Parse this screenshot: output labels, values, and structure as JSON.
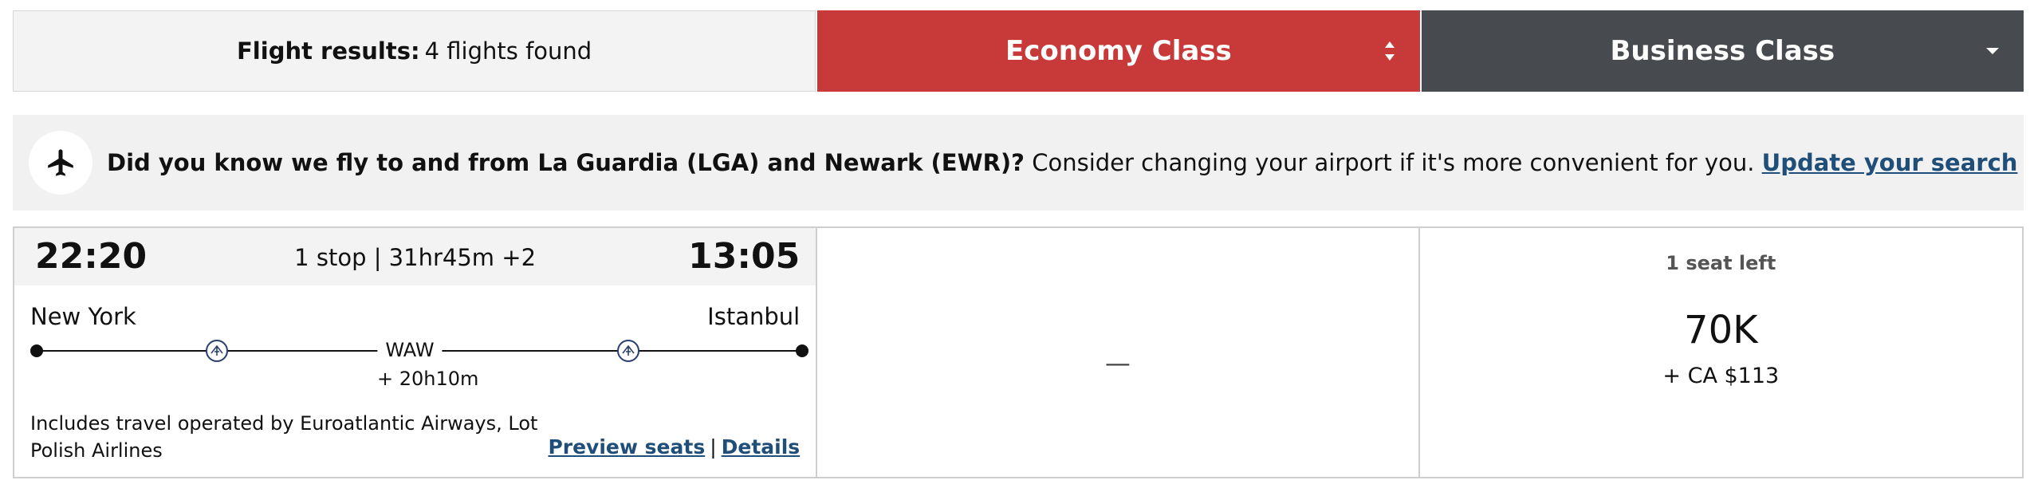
{
  "header": {
    "results_label": "Flight results:",
    "results_count": "4 flights found",
    "cabins": [
      {
        "label": "Economy Class",
        "color": "#c8393a"
      },
      {
        "label": "Business Class",
        "color": "#474a4f"
      }
    ]
  },
  "banner": {
    "icon": "airplane-icon",
    "strong_text": "Did you know we fly to and from La Guardia (LGA) and Newark (EWR)?",
    "text": " Consider changing your airport if it's more convenient for you.",
    "link": "Update your search"
  },
  "flight": {
    "departure_time": "22:20",
    "arrival_time": "13:05",
    "stops_summary": "1 stop | 31hr45m",
    "day_offset": "+2",
    "origin": "New York",
    "destination": "Istanbul",
    "stop_code": "WAW",
    "layover": "+ 20h10m",
    "operators": "Includes travel operated by Euroatlantic Airways, Lot Polish Airlines",
    "preview_seats_link": "Preview seats",
    "separator": "|",
    "details_link": "Details",
    "economy_fare": "—",
    "business_fare": {
      "seats_left": "1 seat left",
      "points": "70K",
      "taxes": "+ CA $113"
    }
  }
}
